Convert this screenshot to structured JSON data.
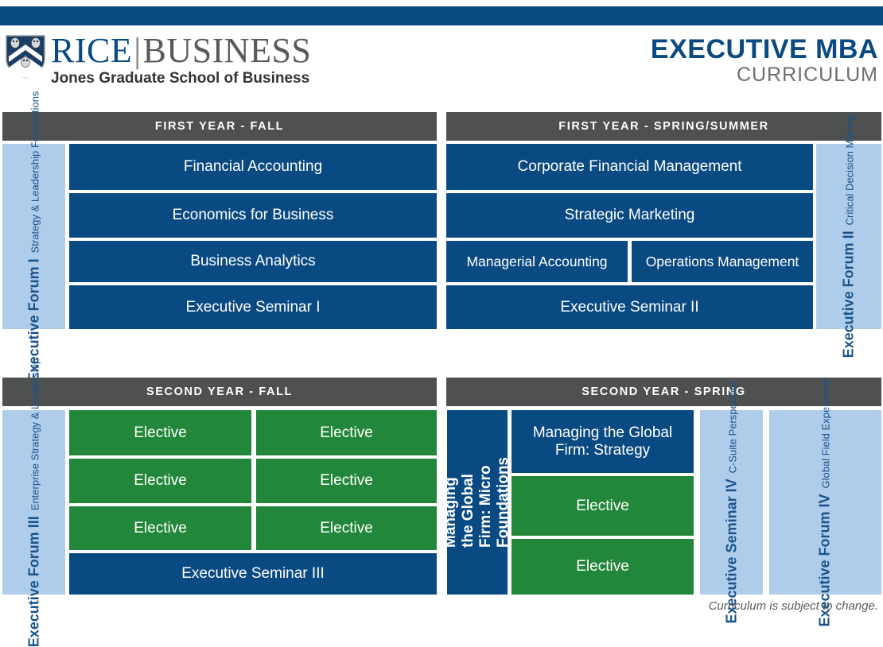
{
  "brand": {
    "logo_rice": "RICE",
    "logo_divider": "|",
    "logo_business": "BUSINESS",
    "logo_school": "Jones Graduate School of Business",
    "title_main": "EXECUTIVE MBA",
    "title_sub": "CURRICULUM",
    "navy": "#0a4a82",
    "green": "#22873a",
    "light_blue": "#afcdea",
    "header_gray": "#4f5151"
  },
  "terms": {
    "y1_fall": {
      "heading": "FIRST YEAR - FALL",
      "forum": {
        "title": "Executive Forum I",
        "subtitle": "Strategy & Leadership Foundations"
      },
      "courses": [
        "Financial Accounting",
        "Economics for Business",
        "Business Analytics",
        "Executive Seminar I"
      ]
    },
    "y1_spring": {
      "heading": "FIRST YEAR - SPRING/SUMMER",
      "forum": {
        "title": "Executive Forum II",
        "subtitle": "Critical Decision Making"
      },
      "courses": [
        "Corporate Financial Management",
        "Strategic Marketing",
        "Managerial Accounting",
        "Operations Management",
        "Executive Seminar II"
      ]
    },
    "y2_fall": {
      "heading": "SECOND YEAR - FALL",
      "forum": {
        "title": "Executive Forum III",
        "subtitle": "Enterprise Strategy & Leadership"
      },
      "electives": [
        "Elective",
        "Elective",
        "Elective",
        "Elective",
        "Elective",
        "Elective"
      ],
      "seminar": "Executive Seminar III"
    },
    "y2_spring": {
      "heading": "SECOND YEAR - SPRING",
      "micro": {
        "title": "Managing the Global Firm: Micro Foundations"
      },
      "courses": [
        "Managing the Global Firm: Strategy",
        "Elective",
        "Elective"
      ],
      "seminar_iv": {
        "title": "Executive Seminar IV",
        "subtitle": "C-Suite Perspective"
      },
      "forum_iv": {
        "title": "Executive Forum IV",
        "subtitle": "Global Field Experience"
      }
    }
  },
  "footer": {
    "note": "Curriculum is subject to change."
  }
}
